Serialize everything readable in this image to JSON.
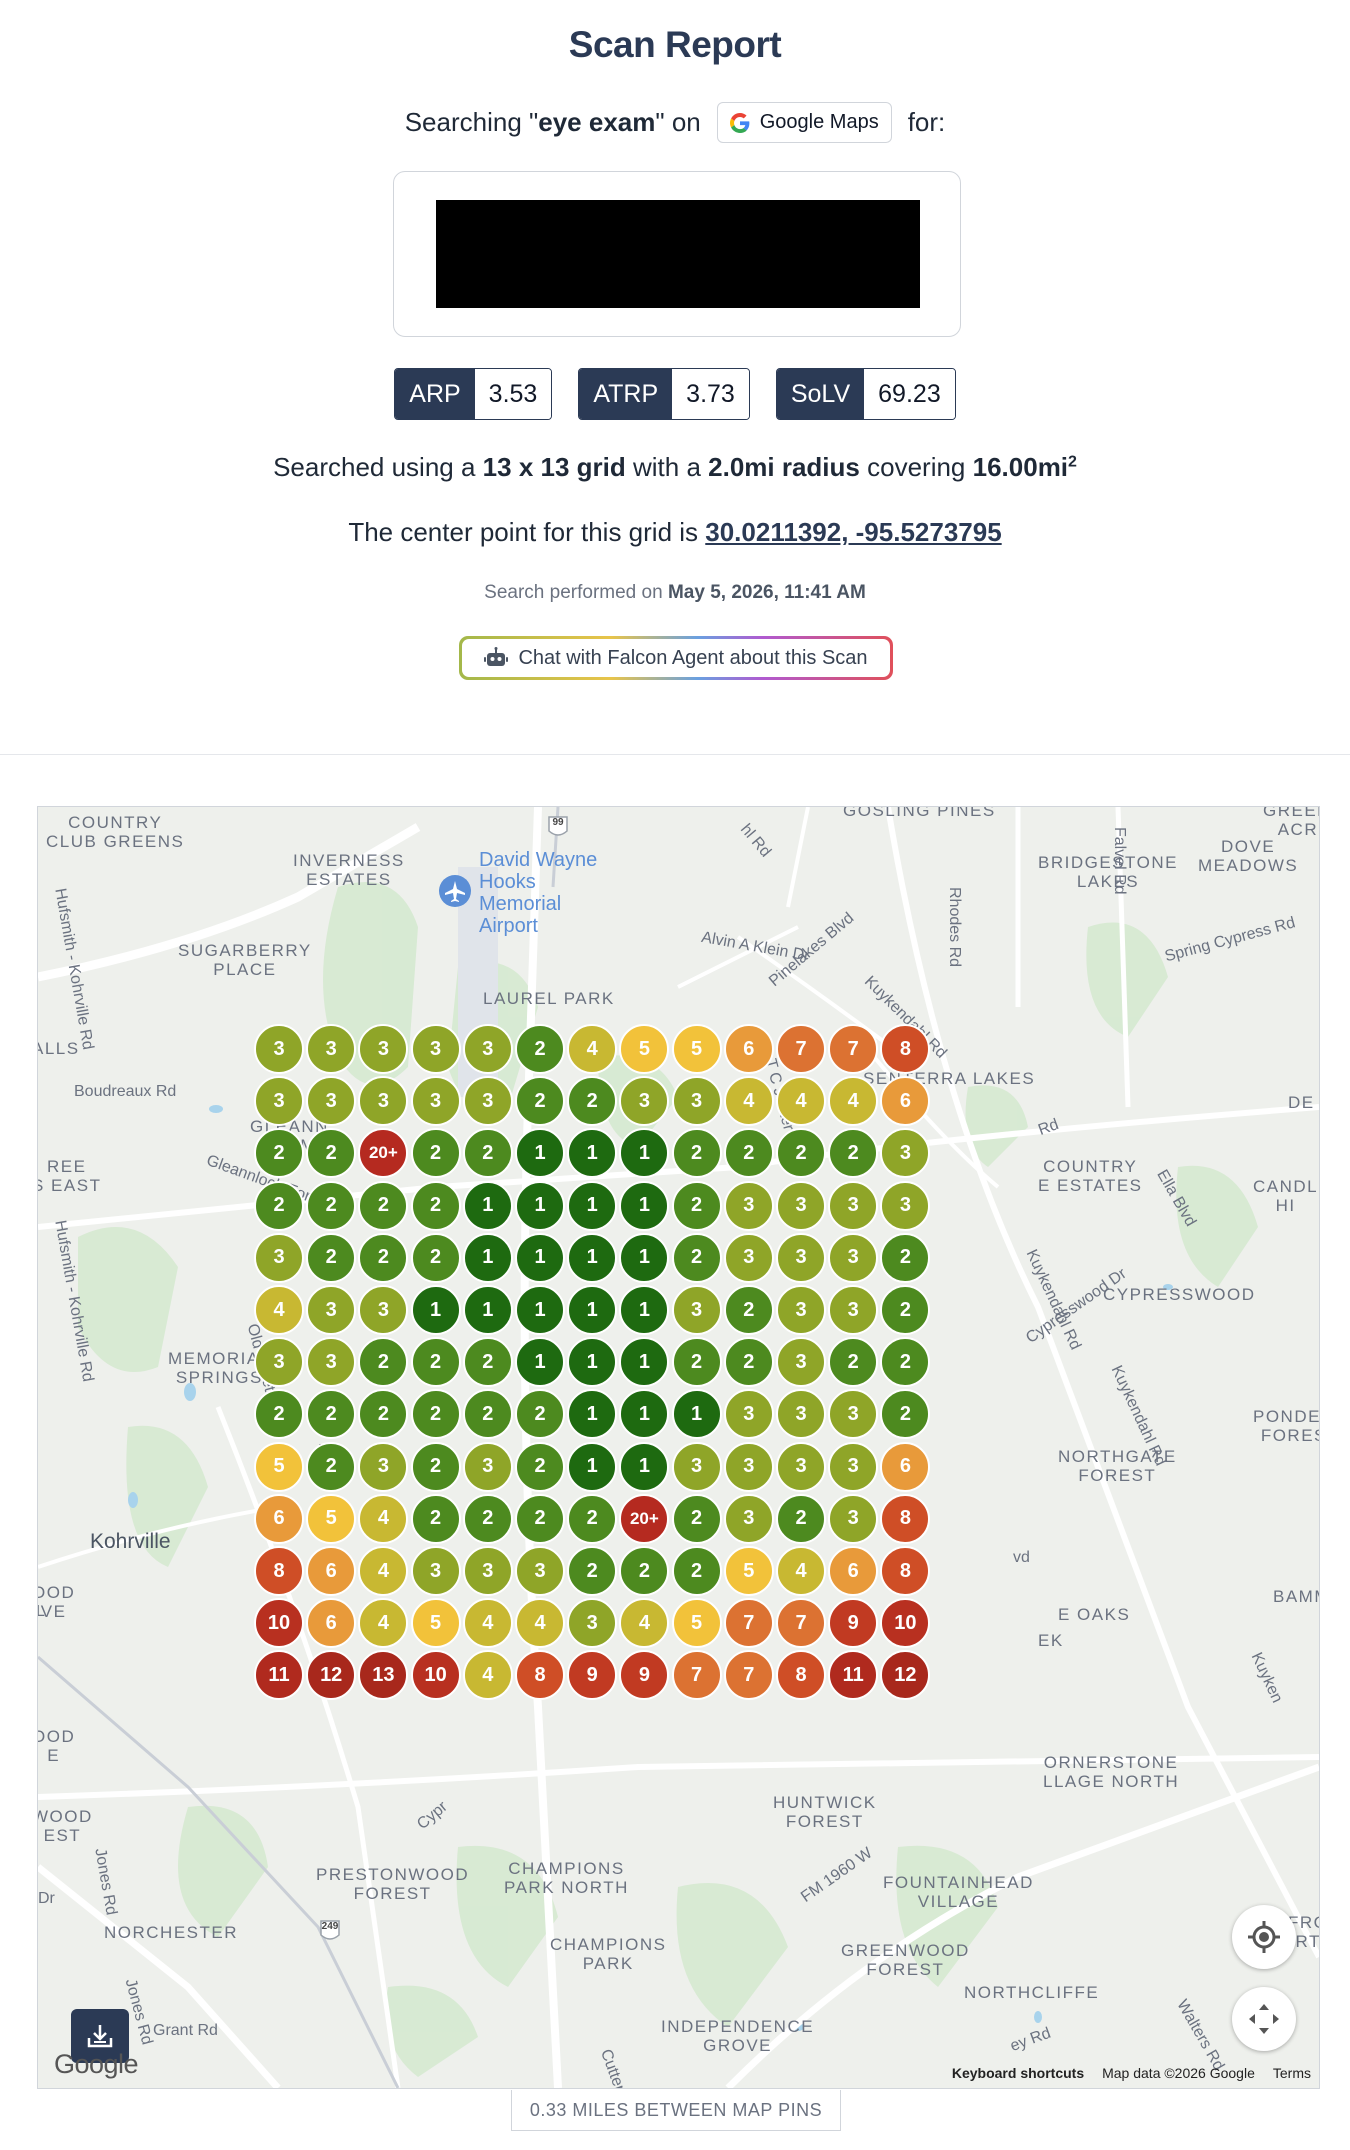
{
  "header": {
    "title": "Scan Report",
    "search_prefix": "Searching \"",
    "keyword": "eye exam",
    "search_mid": "\" on",
    "platform_label": "Google Maps",
    "search_suffix": "for:"
  },
  "metrics": [
    {
      "key": "ARP",
      "value": "3.53"
    },
    {
      "key": "ATRP",
      "value": "3.73"
    },
    {
      "key": "SoLV",
      "value": "69.23"
    }
  ],
  "grid_info": {
    "prefix": "Searched using a",
    "grid_size": "13 x 13 grid",
    "mid1": "with a",
    "radius": "2.0mi radius",
    "mid2": "covering",
    "area": "16.00mi",
    "area_sup": "2"
  },
  "center": {
    "prefix": "The center point for this grid is",
    "coords": "30.0211392, -95.5273795"
  },
  "performed": {
    "prefix": "Search performed on",
    "date": "May 5, 2026, 11:41 AM"
  },
  "chat_button": {
    "label": "Chat with Falcon Agent about this Scan",
    "icon": "robot-icon"
  },
  "map": {
    "area_labels": [
      {
        "text": "COUNTRY\nCLUB GREENS"
      },
      {
        "text": "INVERNESS\nESTATES"
      },
      {
        "text": "GOSLING PINES"
      },
      {
        "text": "GREENGA\nACRES"
      },
      {
        "text": "DOVE\nMEADOWS"
      },
      {
        "text": "BRIDGESTONE\nLAKES"
      },
      {
        "text": "SUGARBERRY\nPLACE"
      },
      {
        "text": "LAUREL PARK"
      },
      {
        "text": "SENTERRA LAKES"
      },
      {
        "text": "ALLS"
      },
      {
        "text": "GLEANN\nFARM"
      },
      {
        "text": "REE\nS EAST"
      },
      {
        "text": "COUNTRY\nE ESTATES"
      },
      {
        "text": "CANDL\nHI"
      },
      {
        "text": "CYPRESSWOOD"
      },
      {
        "text": "MEMORIAL\nSPRINGS"
      },
      {
        "text": "PONDER\nFORES"
      },
      {
        "text": "NORTHGATE\nFOREST"
      },
      {
        "text": "DE"
      },
      {
        "text": "OOD\nVE"
      },
      {
        "text": "E OAKS"
      },
      {
        "text": "EK"
      },
      {
        "text": "BAMMEL"
      },
      {
        "text": "OOD\nE"
      },
      {
        "text": "ORNERSTONE\nLLAGE NORTH"
      },
      {
        "text": "WOOD\nEST"
      },
      {
        "text": "HUNTWICK\nFOREST"
      },
      {
        "text": "PRESTONWOOD\nFOREST"
      },
      {
        "text": "CHAMPIONS\nPARK NORTH"
      },
      {
        "text": "FOUNTAINHEAD\nVILLAGE"
      },
      {
        "text": "NORCHESTER"
      },
      {
        "text": "CHAMPIONS\nPARK"
      },
      {
        "text": "GREENWOOD\nFOREST"
      },
      {
        "text": "NORTHCLIFFE"
      },
      {
        "text": "INDEPENDENCE\nGROVE"
      },
      {
        "text": "FRO\nRT"
      }
    ],
    "airport_label": "David Wayne\nHooks\nMemorial\nAirport",
    "city_label": "Kohrville",
    "road_labels": [
      "Hufsmith - Kohrville Rd",
      "Boudreaux Rd",
      "Gleannloch Forest Dr",
      "Hufsmith - Kohrville Rd",
      "Old Louetta Rd",
      "Alvin A Klein Dr",
      "Pinelakes Blvd",
      "T C Jester",
      "Kuykendahl Rd",
      "Spring Cypress Rd",
      "Rhodes Rd",
      "Falvel Rd",
      "Ella Blvd",
      "Kuykendahl Rd",
      "Cypresswood Dr",
      "Kuykendahl Rd",
      "Jones Rd",
      "Jones Rd",
      "Grant Rd",
      "FM 1960 W",
      "Walters Rd",
      "Cutten R",
      "hl Rd",
      "Kuyken",
      "Cypr",
      "Dr",
      "Rd",
      "L",
      "M",
      "vd",
      "ey Rd"
    ],
    "highway_shields": [
      "99",
      "249"
    ],
    "grid_rows": [
      [
        "3",
        "3",
        "3",
        "3",
        "3",
        "2",
        "4",
        "5",
        "5",
        "6",
        "7",
        "7",
        "8"
      ],
      [
        "3",
        "3",
        "3",
        "3",
        "3",
        "2",
        "2",
        "3",
        "3",
        "4",
        "4",
        "4",
        "6"
      ],
      [
        "2",
        "2",
        "20+",
        "2",
        "2",
        "1",
        "1",
        "1",
        "2",
        "2",
        "2",
        "2",
        "3"
      ],
      [
        "2",
        "2",
        "2",
        "2",
        "1",
        "1",
        "1",
        "1",
        "2",
        "3",
        "3",
        "3",
        "3"
      ],
      [
        "3",
        "2",
        "2",
        "2",
        "1",
        "1",
        "1",
        "1",
        "2",
        "3",
        "3",
        "3",
        "2"
      ],
      [
        "4",
        "3",
        "3",
        "1",
        "1",
        "1",
        "1",
        "1",
        "3",
        "2",
        "3",
        "3",
        "2"
      ],
      [
        "3",
        "3",
        "2",
        "2",
        "2",
        "1",
        "1",
        "1",
        "2",
        "2",
        "3",
        "2",
        "2"
      ],
      [
        "2",
        "2",
        "2",
        "2",
        "2",
        "2",
        "1",
        "1",
        "1",
        "3",
        "3",
        "3",
        "2"
      ],
      [
        "5",
        "2",
        "3",
        "2",
        "3",
        "2",
        "1",
        "1",
        "3",
        "3",
        "3",
        "3",
        "6"
      ],
      [
        "6",
        "5",
        "4",
        "2",
        "2",
        "2",
        "2",
        "20+",
        "2",
        "3",
        "2",
        "3",
        "8"
      ],
      [
        "8",
        "6",
        "4",
        "3",
        "3",
        "3",
        "2",
        "2",
        "2",
        "5",
        "4",
        "6",
        "8"
      ],
      [
        "10",
        "6",
        "4",
        "5",
        "4",
        "4",
        "3",
        "4",
        "5",
        "7",
        "7",
        "9",
        "10"
      ],
      [
        "11",
        "12",
        "13",
        "10",
        "4",
        "8",
        "9",
        "9",
        "7",
        "7",
        "8",
        "11",
        "12"
      ]
    ],
    "rank_colors": {
      "1": "#1e6a10",
      "2": "#4d8a1f",
      "3": "#8fa528",
      "4": "#c8b832",
      "5": "#f2c23a",
      "6": "#e89a3a",
      "7": "#dc7232",
      "8": "#cf4e26",
      "9": "#c13a22",
      "10": "#b83020",
      "11": "#b02a1e",
      "12": "#a8281c",
      "13": "#a8281c",
      "20+": "#b52a20"
    },
    "logo": "Google",
    "attribution": {
      "shortcuts": "Keyboard shortcuts",
      "data": "Map data ©2026 Google",
      "terms": "Terms"
    },
    "controls": {
      "locate_icon": "crosshair-icon",
      "fullscreen_icon": "fullscreen-icon",
      "download_icon": "download-icon"
    }
  },
  "footer": {
    "distance_label": "0.33 MILES BETWEEN MAP PINS"
  }
}
